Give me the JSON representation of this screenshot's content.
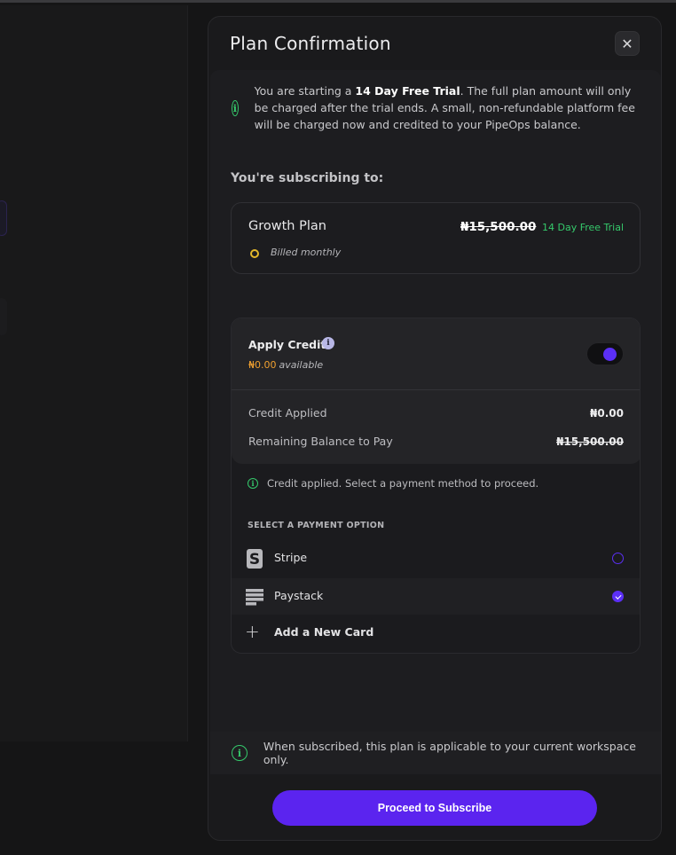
{
  "modal": {
    "title": "Plan Confirmation",
    "close_icon": "close-icon"
  },
  "trial_note": {
    "prefix": "You are starting a ",
    "highlight": "14 Day Free Trial",
    "suffix": ". The full plan amount will only be charged after the trial ends. A small, non-refundable platform fee will be charged now and credited to your PipeOps balance."
  },
  "subscribing_label": "You're subscribing to:",
  "plan": {
    "name": "Growth Plan",
    "price": "₦15,500.00",
    "trial_badge": "14 Day Free Trial",
    "billing": "Billed monthly"
  },
  "credit": {
    "title": "Apply Credit",
    "available_amount": "₦0.00",
    "available_word": "available",
    "toggle_on": true,
    "applied_label": "Credit Applied",
    "applied_value": "₦0.00",
    "remaining_label": "Remaining Balance to Pay",
    "remaining_value": "₦15,500.00"
  },
  "applied_note": "Credit applied. Select a payment method to proceed.",
  "payment": {
    "section_label": "SELECT A PAYMENT OPTION",
    "options": [
      {
        "label": "Stripe",
        "icon": "stripe-icon",
        "selected": false
      },
      {
        "label": "Paystack",
        "icon": "paystack-icon",
        "selected": true
      }
    ],
    "add_card_label": "Add a New Card"
  },
  "footer_note": "When subscribed, this plan is applicable to your current workspace only.",
  "proceed_label": "Proceed to Subscribe",
  "colors": {
    "accent": "#5b24ef",
    "success": "#35c96b",
    "warning": "#f0a030",
    "billing_dot": "#e3b82b"
  }
}
